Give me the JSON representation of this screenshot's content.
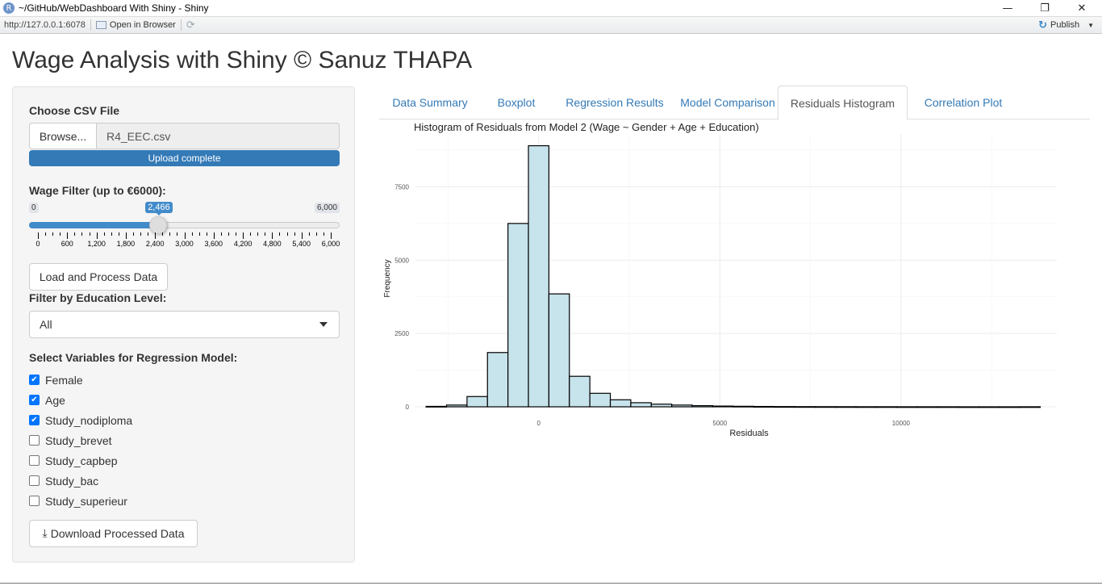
{
  "window": {
    "app_icon": "R",
    "title": "~/GitHub/WebDashboard With Shiny - Shiny",
    "minimize_icon": "minimize-icon",
    "restore_icon": "restore-icon",
    "close_icon": "close-icon"
  },
  "toolbar": {
    "url": "http://127.0.0.1:6078",
    "open_in_browser": "Open in Browser",
    "publish": "Publish"
  },
  "page": {
    "title": "Wage Analysis with Shiny © Sanuz THAPA"
  },
  "sidebar": {
    "file_label": "Choose CSV File",
    "browse_label": "Browse...",
    "file_name": "R4_EEC.csv",
    "progress_text": "Upload complete",
    "wage_label": "Wage Filter (up to €6000):",
    "slider": {
      "min": 0,
      "max": 6000,
      "value": 2466,
      "min_label": "0",
      "max_label": "6,000",
      "value_label": "2,466",
      "ticks": [
        "0",
        "600",
        "1,200",
        "1,800",
        "2,400",
        "3,000",
        "3,600",
        "4,200",
        "4,800",
        "5,400",
        "6,000"
      ]
    },
    "load_button": "Load and Process Data",
    "education_label": "Filter by Education Level:",
    "education_selected": "All",
    "variables_label": "Select Variables for Regression Model:",
    "variables": [
      {
        "label": "Female",
        "checked": true
      },
      {
        "label": "Age",
        "checked": true
      },
      {
        "label": "Study_nodiploma",
        "checked": true
      },
      {
        "label": "Study_brevet",
        "checked": false
      },
      {
        "label": "Study_capbep",
        "checked": false
      },
      {
        "label": "Study_bac",
        "checked": false
      },
      {
        "label": "Study_superieur",
        "checked": false
      }
    ],
    "download_button": "Download Processed Data"
  },
  "tabs": [
    {
      "label": "Data Summary",
      "active": false
    },
    {
      "label": "Boxplot",
      "active": false
    },
    {
      "label": "Regression Results",
      "active": false
    },
    {
      "label": "Model Comparison",
      "active": false
    },
    {
      "label": "Residuals Histogram",
      "active": true
    },
    {
      "label": "Correlation Plot",
      "active": false
    }
  ],
  "chart_data": {
    "type": "bar",
    "title": "Histogram of Residuals from Model 2 (Wage ~ Gender + Age + Education)",
    "xlabel": "Residuals",
    "ylabel": "Frequency",
    "fill": "#c7e3ec",
    "stroke": "#000000",
    "grid": true,
    "xlim": [
      -3400,
      14300
    ],
    "ylim": [
      0,
      9300
    ],
    "x_ticks": [
      0,
      5000,
      10000
    ],
    "y_ticks": [
      0,
      2500,
      5000,
      7500
    ],
    "bin_width": 565,
    "bins": [
      {
        "x": -2825,
        "count": 15
      },
      {
        "x": -2260,
        "count": 60
      },
      {
        "x": -1695,
        "count": 350
      },
      {
        "x": -1130,
        "count": 1850
      },
      {
        "x": -565,
        "count": 6250
      },
      {
        "x": 0,
        "count": 8900
      },
      {
        "x": 565,
        "count": 3850
      },
      {
        "x": 1130,
        "count": 1040
      },
      {
        "x": 1695,
        "count": 460
      },
      {
        "x": 2260,
        "count": 240
      },
      {
        "x": 2825,
        "count": 140
      },
      {
        "x": 3390,
        "count": 90
      },
      {
        "x": 3955,
        "count": 60
      },
      {
        "x": 4520,
        "count": 40
      },
      {
        "x": 5085,
        "count": 25
      },
      {
        "x": 5650,
        "count": 18
      },
      {
        "x": 6215,
        "count": 12
      },
      {
        "x": 6780,
        "count": 8
      },
      {
        "x": 7345,
        "count": 6
      },
      {
        "x": 7910,
        "count": 5
      },
      {
        "x": 8475,
        "count": 4
      },
      {
        "x": 9040,
        "count": 3
      },
      {
        "x": 9605,
        "count": 3
      },
      {
        "x": 10170,
        "count": 2
      },
      {
        "x": 10735,
        "count": 2
      },
      {
        "x": 11300,
        "count": 2
      },
      {
        "x": 11865,
        "count": 1
      },
      {
        "x": 12430,
        "count": 1
      },
      {
        "x": 12995,
        "count": 1
      },
      {
        "x": 13560,
        "count": 2
      }
    ]
  }
}
